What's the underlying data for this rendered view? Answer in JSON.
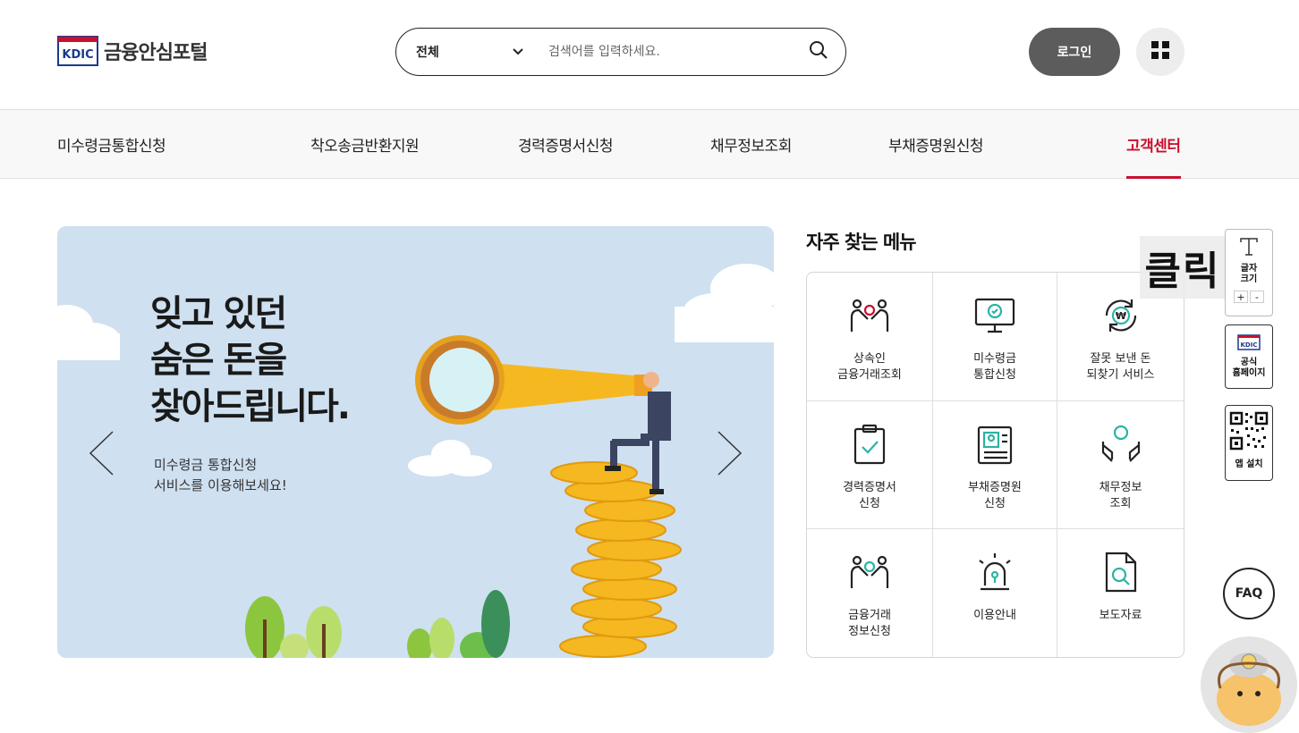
{
  "header": {
    "logo_mark": "KDIC",
    "logo_text": "금융안심포털",
    "search": {
      "category": "전체",
      "placeholder": "검색어를 입력하세요."
    },
    "login_label": "로그인"
  },
  "gnb": {
    "items": [
      {
        "label": "미수령금통합신청"
      },
      {
        "label": "착오송금반환지원"
      },
      {
        "label": "경력증명서신청"
      },
      {
        "label": "채무정보조회"
      },
      {
        "label": "부채증명원신청"
      },
      {
        "label": "고객센터"
      }
    ]
  },
  "banner": {
    "title_lines": [
      "잊고 있던",
      "숨은 돈을",
      "찾아드립니다."
    ],
    "sub_lines": [
      "미수령금 통합신청",
      "서비스를 이용해보세요!"
    ]
  },
  "quick": {
    "title": "자주 찾는 메뉴",
    "items": [
      {
        "label": "상속인\n금융거래조회",
        "icon": "handshake-won-icon"
      },
      {
        "label": "미수령금\n통합신청",
        "icon": "monitor-check-icon"
      },
      {
        "label": "잘못 보낸 돈\n되찾기 서비스",
        "icon": "won-refresh-icon"
      },
      {
        "label": "경력증명서\n신청",
        "icon": "clipboard-check-icon"
      },
      {
        "label": "부채증명원\n신청",
        "icon": "id-document-icon"
      },
      {
        "label": "채무정보\n조회",
        "icon": "hands-won-icon"
      },
      {
        "label": "금융거래\n정보신청",
        "icon": "handshake-won-icon"
      },
      {
        "label": "이용안내",
        "icon": "siren-icon"
      },
      {
        "label": "보도자료",
        "icon": "document-search-icon"
      }
    ]
  },
  "overlay": {
    "text": "클릭"
  },
  "side": {
    "font_size": {
      "label": "글자\n크기",
      "plus": "+",
      "minus": "-"
    },
    "home": {
      "mark": "KDIC",
      "label": "공식\n홈페이지"
    },
    "app": {
      "label": "앱 설치"
    },
    "faq": "FAQ"
  },
  "colors": {
    "accent": "#c8102e",
    "icon_teal": "#2bb3a6",
    "banner_bg": "#cfe0f0",
    "login_bg": "#5c5c5c"
  }
}
